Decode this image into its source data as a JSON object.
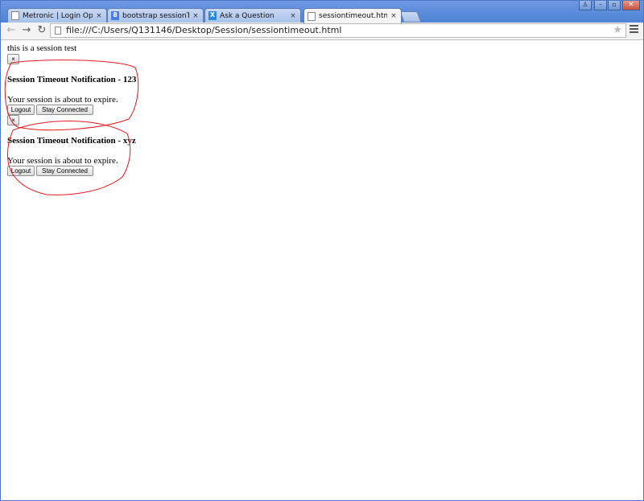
{
  "browser": {
    "tabs": [
      {
        "title": "Metronic | Login Options",
        "icon": "page-icon",
        "close": "×"
      },
      {
        "title": "bootstrap sessionTimeout",
        "icon": "google-icon",
        "icon_text": "8",
        "close": "×"
      },
      {
        "title": "Ask a Question",
        "icon": "x-icon",
        "icon_text": "X",
        "close": "×"
      },
      {
        "title": "sessiontimeout.html",
        "icon": "page-icon",
        "close": "×"
      }
    ],
    "active_tab": 3,
    "address": "file:///C:/Users/Q131146/Desktop/Session/sessiontimeout.html",
    "nav": {
      "back": "←",
      "forward": "→",
      "reload": "↻"
    },
    "window_controls": {
      "user": "♙",
      "minimize": "–",
      "maximize": "▫",
      "close": "✕"
    },
    "star": "★"
  },
  "page": {
    "intro": "this is a session test",
    "dialogs": [
      {
        "close_label": "×",
        "title": "Session Timeout Notification - 123",
        "message": "Your session is about to expire.",
        "logout_label": "Logout",
        "stay_label": "Stay Connected"
      },
      {
        "close_label": "×",
        "title": "Session Timeout Notification - xyz",
        "message": "Your session is about to expire.",
        "logout_label": "Logout",
        "stay_label": "Stay Connected"
      }
    ]
  },
  "annotation_color": "#e0191f"
}
